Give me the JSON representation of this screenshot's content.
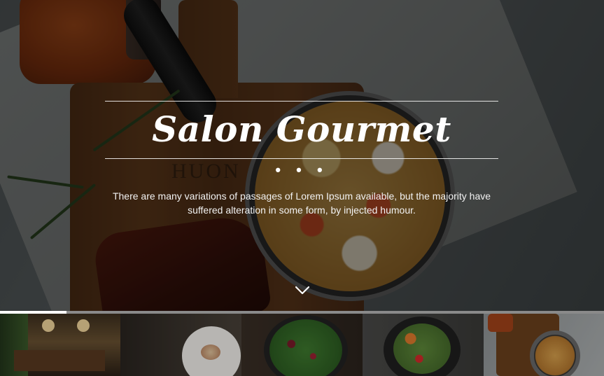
{
  "hero": {
    "title": "Salon Gourmet",
    "dots": "• • •",
    "tagline_line1": "There are many variations of passages of Lorem Ipsum available, but the majority have",
    "tagline_line2": "suffered alteration in some form, by injected humour.",
    "board_label": "HUON",
    "scroll_icon": "chevron-down-icon"
  },
  "slider": {
    "progress_fraction": 0.11,
    "active_index": 0,
    "thumbnails": [
      {
        "name": "restaurant-interior",
        "icon": "photo"
      },
      {
        "name": "plated-dessert",
        "icon": "photo"
      },
      {
        "name": "green-salad",
        "icon": "photo"
      },
      {
        "name": "vegetable-bowl",
        "icon": "photo"
      },
      {
        "name": "frittata-pan",
        "icon": "photo"
      }
    ]
  },
  "colors": {
    "text": "#ffffff",
    "overlay": "#000000",
    "progress_track": "#8a8a8a",
    "progress_fill": "#ffffff"
  }
}
